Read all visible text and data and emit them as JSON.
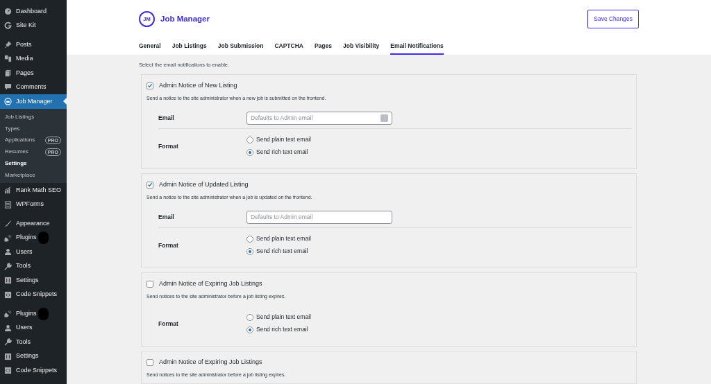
{
  "sidebar": {
    "groups": [
      {
        "items": [
          {
            "label": "Dashboard",
            "selected": false
          },
          {
            "label": "Site Kit",
            "selected": false
          }
        ]
      },
      {
        "items": [
          {
            "label": "Posts",
            "selected": false
          },
          {
            "label": "Media",
            "selected": false
          },
          {
            "label": "Pages",
            "selected": false
          },
          {
            "label": "Comments",
            "selected": false
          },
          {
            "label": "Job Manager",
            "selected": true,
            "children": [
              {
                "label": "Job Listings",
                "selected": false
              },
              {
                "label": "Types",
                "selected": false
              },
              {
                "label": "Applications",
                "selected": false,
                "badge": "PRO"
              },
              {
                "label": "Resumes",
                "selected": false,
                "badge": "PRO"
              },
              {
                "label": "Settings",
                "selected": true
              },
              {
                "label": "Marketplace",
                "selected": false
              }
            ]
          },
          {
            "label": "Rank Math SEO",
            "selected": false
          },
          {
            "label": "WPForms",
            "selected": false
          }
        ]
      },
      {
        "items": [
          {
            "label": "Appearance",
            "selected": false
          },
          {
            "label": "Plugins",
            "selected": false,
            "redacted": true
          },
          {
            "label": "Users",
            "selected": false
          },
          {
            "label": "Tools",
            "selected": false
          },
          {
            "label": "Settings",
            "selected": false
          },
          {
            "label": "Code Snippets",
            "selected": false
          }
        ]
      },
      {
        "items": [
          {
            "label": "Plugins",
            "selected": false,
            "redacted": true
          },
          {
            "label": "Users",
            "selected": false
          },
          {
            "label": "Tools",
            "selected": false
          },
          {
            "label": "Settings",
            "selected": false
          },
          {
            "label": "Code Snippets",
            "selected": false
          }
        ]
      }
    ]
  },
  "header": {
    "logo": "JM",
    "title": "Job Manager",
    "save_button": "Save Changes"
  },
  "tabs": [
    {
      "label": "General",
      "selected": false
    },
    {
      "label": "Job Listings",
      "selected": false
    },
    {
      "label": "Job Submission",
      "selected": false
    },
    {
      "label": "CAPTCHA",
      "selected": false
    },
    {
      "label": "Pages",
      "selected": false
    },
    {
      "label": "Job Visibility",
      "selected": false
    },
    {
      "label": "Email Notifications",
      "selected": true
    }
  ],
  "intro": "Select the email notifications to enable.",
  "notifications": [
    {
      "title": "Admin Notice of New Listing",
      "checked": true,
      "description": "Send a notice to the site administrator when a new job is submitted on the frontend.",
      "fields": [
        {
          "kind": "email",
          "label": "Email",
          "placeholder": "Defaults to Admin email",
          "autofill_icon": true
        },
        {
          "kind": "format",
          "label": "Format",
          "options": [
            {
              "label": "Send plain text email",
              "selected": false
            },
            {
              "label": "Send rich text email",
              "selected": true
            }
          ]
        }
      ]
    },
    {
      "title": "Admin Notice of Updated Listing",
      "checked": true,
      "description": "Send a notice to the site administrator when a job is updated on the frontend.",
      "fields": [
        {
          "kind": "email",
          "label": "Email",
          "placeholder": "Defaults to Admin email",
          "autofill_icon": false
        },
        {
          "kind": "format",
          "label": "Format",
          "options": [
            {
              "label": "Send plain text email",
              "selected": false
            },
            {
              "label": "Send rich text email",
              "selected": true
            }
          ]
        }
      ]
    },
    {
      "title": "Admin Notice of Expiring Job Listings",
      "checked": false,
      "description": "Send notices to the site administrator before a job listing expires.",
      "fields": [
        {
          "kind": "format",
          "label": "Format",
          "options": [
            {
              "label": "Send plain text email",
              "selected": false
            },
            {
              "label": "Send rich text email",
              "selected": true
            }
          ]
        }
      ]
    },
    {
      "title": "Admin Notice of Expiring Job Listings",
      "checked": false,
      "description": "Send notices to the site administrator before a job listing expires."
    }
  ]
}
